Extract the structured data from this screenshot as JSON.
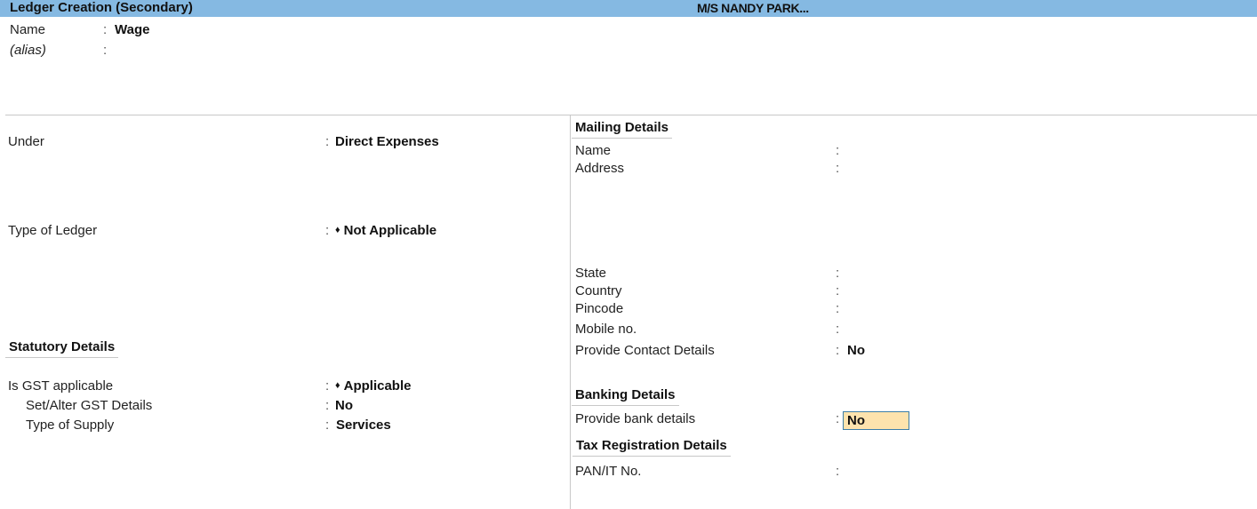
{
  "title_bar": {
    "screen_title": "Ledger Creation (Secondary)",
    "company_name": "M/S NANDY PARK..."
  },
  "header_fields": {
    "name_label": "Name",
    "name_value": "Wage",
    "alias_label": "(alias)",
    "alias_value": ""
  },
  "left_panel": {
    "under": {
      "label": "Under",
      "value": "Direct Expenses"
    },
    "type_of_ledger": {
      "label": "Type of Ledger",
      "value": "Not Applicable",
      "marker": "♦"
    },
    "statutory_details": {
      "heading": "Statutory Details",
      "is_gst_applicable": {
        "label": "Is GST applicable",
        "value": "Applicable",
        "marker": "♦"
      },
      "set_alter_gst_details": {
        "label": "Set/Alter GST Details",
        "value": "No"
      },
      "type_of_supply": {
        "label": "Type of Supply",
        "value": "Services"
      }
    }
  },
  "right_panel": {
    "mailing_details": {
      "heading": "Mailing Details",
      "fields": [
        {
          "label": "Name",
          "value": ""
        },
        {
          "label": "Address",
          "value": ""
        },
        {
          "label": "State",
          "value": ""
        },
        {
          "label": "Country",
          "value": ""
        },
        {
          "label": "Pincode",
          "value": ""
        },
        {
          "label": "Mobile no.",
          "value": ""
        },
        {
          "label": "Provide Contact Details",
          "value": "No"
        }
      ]
    },
    "banking_details": {
      "heading": "Banking Details",
      "provide_bank_details": {
        "label": "Provide bank details",
        "value": "No"
      }
    },
    "tax_registration_details": {
      "heading": "Tax Registration Details",
      "pan_it_no": {
        "label": "PAN/IT No.",
        "value": ""
      }
    }
  },
  "colon": ":",
  "colors": {
    "title_bar_bg": "#85b9e2",
    "focus_field_bg": "#fde3ad",
    "focus_field_border": "#3c7ea8"
  }
}
